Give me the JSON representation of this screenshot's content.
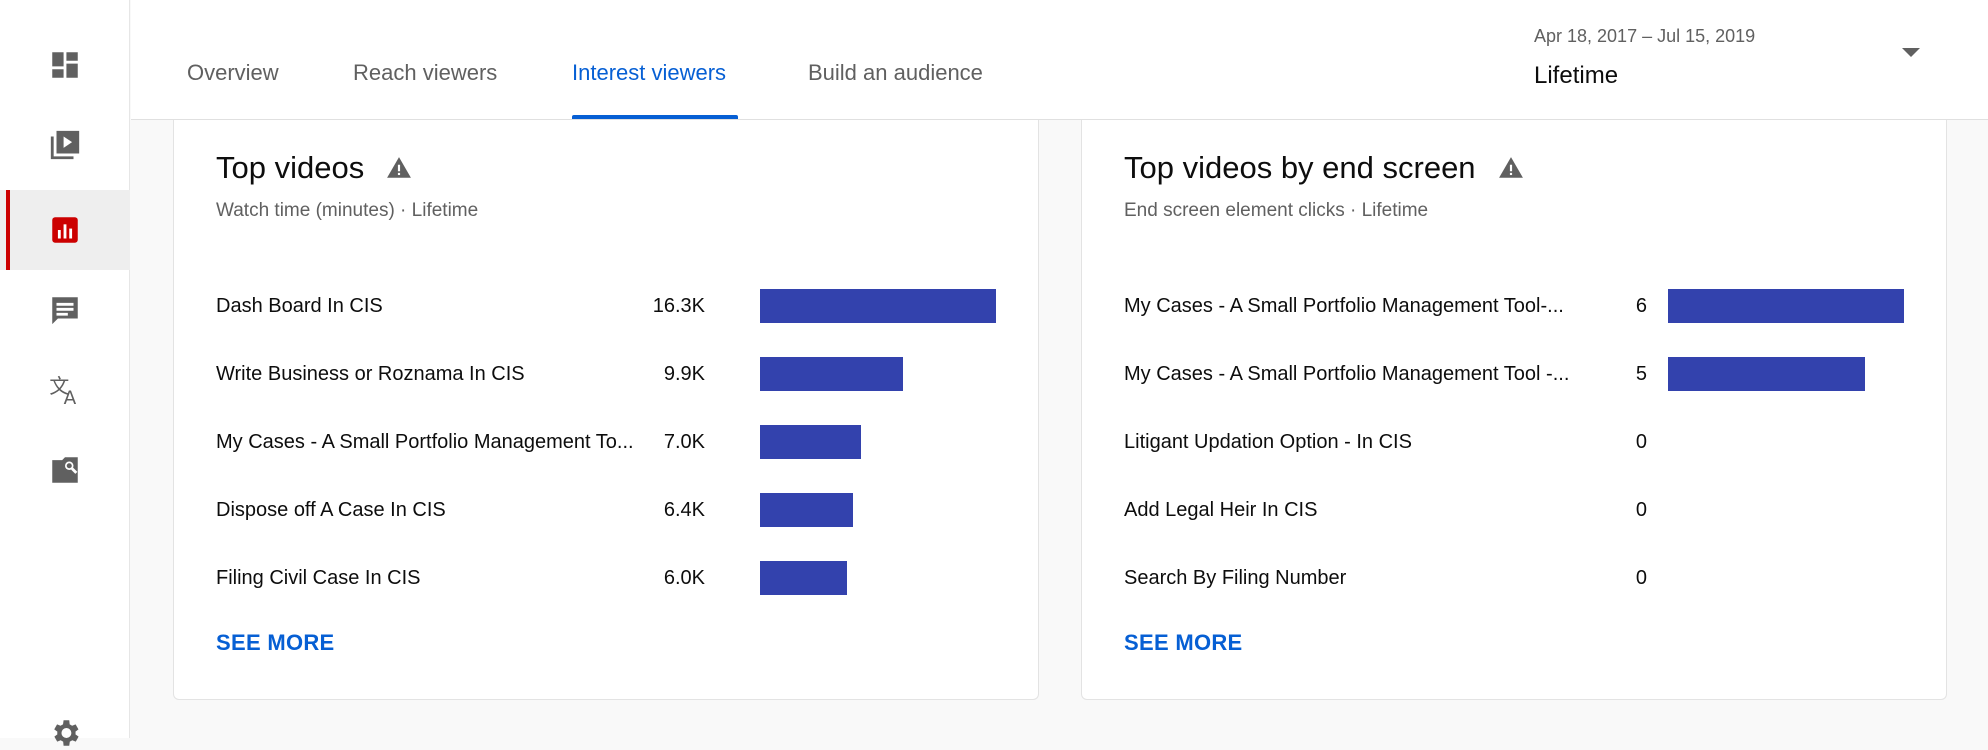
{
  "tabs": [
    {
      "label": "Overview",
      "active": false
    },
    {
      "label": "Reach viewers",
      "active": false
    },
    {
      "label": "Interest viewers",
      "active": true
    },
    {
      "label": "Build an audience",
      "active": false
    }
  ],
  "date_filter": {
    "range": "Apr 18, 2017 – Jul 15, 2019",
    "period": "Lifetime"
  },
  "rail": [
    "dashboard-icon",
    "content-icon",
    "analytics-icon",
    "comments-icon",
    "translations-icon",
    "copyright-icon",
    "settings-icon"
  ],
  "accent_color": "#065fd4",
  "bar_color": "#3342ad",
  "card_left": {
    "title": "Top videos",
    "subtitle": "Watch time (minutes) · Lifetime",
    "rows": [
      {
        "label": "Dash Board In CIS",
        "value": "16.3K",
        "amount": 16.3
      },
      {
        "label": "Write Business or Roznama In CIS",
        "value": "9.9K",
        "amount": 9.9
      },
      {
        "label": "My Cases - A Small Portfolio Management To...",
        "value": "7.0K",
        "amount": 7.0
      },
      {
        "label": "Dispose off A Case In CIS",
        "value": "6.4K",
        "amount": 6.4
      },
      {
        "label": "Filing Civil Case In CIS",
        "value": "6.0K",
        "amount": 6.0
      }
    ],
    "see_more": "SEE MORE"
  },
  "card_right": {
    "title": "Top videos by end screen",
    "subtitle": "End screen element clicks · Lifetime",
    "rows": [
      {
        "label": "My Cases - A Small Portfolio Management Tool-...",
        "value": "6",
        "amount": 6
      },
      {
        "label": "My Cases - A Small Portfolio Management Tool -...",
        "value": "5",
        "amount": 5
      },
      {
        "label": "Litigant Updation Option - In CIS",
        "value": "0",
        "amount": 0
      },
      {
        "label": "Add Legal Heir In CIS",
        "value": "0",
        "amount": 0
      },
      {
        "label": "Search By Filing Number",
        "value": "0",
        "amount": 0
      }
    ],
    "see_more": "SEE MORE"
  }
}
